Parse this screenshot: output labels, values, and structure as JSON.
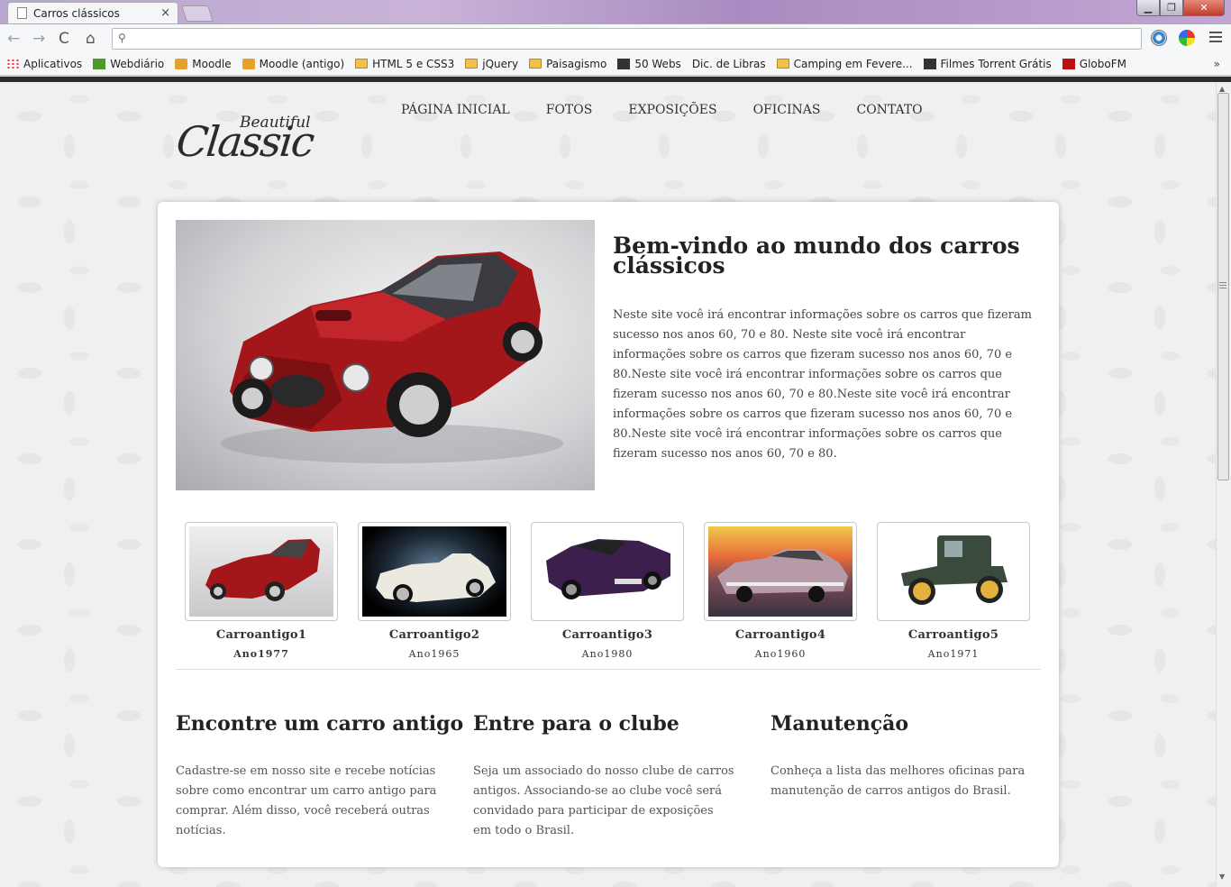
{
  "browser": {
    "tab_title": "Carros clássicos",
    "tab_close": "×",
    "min_label": "▁",
    "max_label": "❐",
    "close_label": "✕",
    "back": "←",
    "forward": "→",
    "reload": "C",
    "home": "⌂",
    "search_glyph": "⚲",
    "url": "",
    "bookmarks": [
      {
        "label": "Aplicativos",
        "icon": "apps-icon"
      },
      {
        "label": "Webdiário",
        "icon": "webdiario-icon"
      },
      {
        "label": "Moodle",
        "icon": "moodle-icon"
      },
      {
        "label": "Moodle (antigo)",
        "icon": "moodle-icon"
      },
      {
        "label": "HTML 5 e CSS3",
        "icon": "folder-icon"
      },
      {
        "label": "jQuery",
        "icon": "folder-icon"
      },
      {
        "label": "Paisagismo",
        "icon": "folder-icon"
      },
      {
        "label": "50 Webs",
        "icon": "50webs-icon"
      },
      {
        "label": "Dic. de Libras",
        "icon": "page-icon"
      },
      {
        "label": "Camping em Fevere...",
        "icon": "folder-icon"
      },
      {
        "label": "Filmes Torrent Grátis",
        "icon": "play-icon"
      },
      {
        "label": "GloboFM",
        "icon": "globofm-icon"
      }
    ],
    "bookmarks_more": "»"
  },
  "site": {
    "logo_small": "Beautiful",
    "logo_big": "Classic",
    "nav": [
      "PÁGINA INICIAL",
      "FOTOS",
      "EXPOSIÇÕES",
      "OFICINAS",
      "CONTATO"
    ],
    "welcome_title": "Bem-vindo ao mundo dos carros clássicos",
    "welcome_text": "Neste site você irá encontrar informações sobre os carros que fizeram sucesso nos anos 60, 70 e 80. Neste site você irá encontrar informações sobre os carros que fizeram sucesso nos anos 60, 70 e 80.Neste site você irá encontrar informações sobre os carros que fizeram sucesso nos anos 60, 70 e 80.Neste site você irá encontrar informações sobre os carros que fizeram sucesso nos anos 60, 70 e 80.Neste site você irá encontrar informações sobre os carros que fizeram sucesso nos anos 60, 70 e 80.",
    "gallery": [
      {
        "title": "Carroantigo1",
        "year": "Ano1977"
      },
      {
        "title": "Carroantigo2",
        "year": "Ano1965"
      },
      {
        "title": "Carroantigo3",
        "year": "Ano1980"
      },
      {
        "title": "Carroantigo4",
        "year": "Ano1960"
      },
      {
        "title": "Carroantigo5",
        "year": "Ano1971"
      }
    ],
    "columns": [
      {
        "title": "Encontre um carro antigo",
        "text": "Cadastre-se em nosso site e recebe notícias sobre como encontrar um carro antigo para comprar. Além disso, você receberá outras notícias."
      },
      {
        "title": "Entre para o clube",
        "text": "Seja um associado do nosso clube de carros antigos. Associando-se ao clube você será convidado para participar de exposições em todo o Brasil."
      },
      {
        "title": "Manutenção",
        "text": "Conheça a lista das melhores oficinas para manutenção de carros antigos do Brasil."
      }
    ]
  },
  "colors": {
    "car_red": "#a3171b",
    "car_white": "#ece9e0",
    "car_purple": "#3d1f4d",
    "car_pink": "#b79aa8",
    "car_green": "#3a4a3c"
  }
}
